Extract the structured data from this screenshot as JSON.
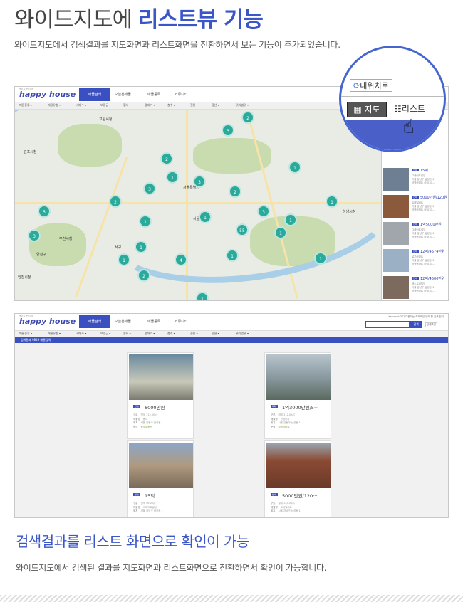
{
  "header": {
    "title_part1": "와이드지도에",
    "title_part2": "리스트뷰 기능",
    "subtitle": "와이드지도에서 검색결과를 지도화면과 리스트화면을 전환하면서 보는 기능이 추가되었습니다."
  },
  "app": {
    "logo": "happy house",
    "logo_small": "좋은집 좋은세상",
    "nav_active": "매물검색",
    "nav_items": [
      "오늘본매물",
      "매물등록",
      "커뮤니티"
    ],
    "filters": [
      "매물종류 ▾",
      "매물유형 ▾",
      "세대수 ▾",
      "보증금 ▾",
      "월세 ▾",
      "평대가 ▾",
      "층수 ▾",
      "전용 ▾",
      "옵션 ▾",
      "위치범위 ▾"
    ]
  },
  "map": {
    "labels": [
      "고양시청",
      "김포시청",
      "서울특별시",
      "서울시청",
      "부천시청",
      "인천시청",
      "하남시청",
      "서구",
      "양천구"
    ],
    "clusters": [
      "2",
      "3",
      "2",
      "1",
      "3",
      "3",
      "2",
      "1",
      "2",
      "3",
      "1",
      "5",
      "3",
      "1",
      "1",
      "55",
      "1",
      "1",
      "1",
      "4",
      "1",
      "2",
      "1",
      "1",
      "1"
    ]
  },
  "magnifier": {
    "location_button": "내위치로",
    "map_button": "지도",
    "list_button": "리스트"
  },
  "side_list": [
    {
      "tag": "전세",
      "price": "15억",
      "desc1": "그레이트빌딩",
      "desc2": "서울 강남구 삼성동 1",
      "desc3": "삼평아파트 @ 010-..."
    },
    {
      "tag": "전세",
      "price": "5000만원/120원",
      "desc1": "르네빌리트",
      "desc2": "서울 강남구 삼성동 1",
      "desc3": "삼평아파트 @ 010-..."
    },
    {
      "tag": "전세",
      "price": "1억5000만원",
      "desc1": "그레이트빌딩",
      "desc2": "서울 강남구 삼성동 1",
      "desc3": "삼평아파트 @ 010-..."
    },
    {
      "tag": "전세",
      "price": "12억/4574만원",
      "desc1": "넓은아파트",
      "desc2": "서울 강남구 삼성동 1",
      "desc3": "삼평아파트 @ 010-..."
    },
    {
      "tag": "전세",
      "price": "12억/4500만원",
      "desc1": "엑스트라빌딩",
      "desc2": "서울 강남구 삼성동 1",
      "desc3": "삼평아파트 @ 010-..."
    }
  ],
  "list_view": {
    "top_right": "Keyword 어디로 원하는 조회조건 입력 할 검색 찾기",
    "search_button": "검색",
    "detail_button": "상세조건",
    "result_bar": "검색결과 9849 매물검색",
    "cards": [
      {
        "tag": "전세",
        "price": "6000만원",
        "r1k": "구분",
        "r1v": "전세 112.00㎡",
        "r2k": "매물명",
        "r2v": "동아",
        "r3k": "위치",
        "r3v": "서울 강동구 삼성동 1",
        "r4k": "문의",
        "r4v": "한국부동산"
      },
      {
        "tag": "매매",
        "price": "1억3000만원/5···",
        "r1k": "구분",
        "r1v": "매매 112.00㎡",
        "r2k": "매물명",
        "r2v": "한경아파",
        "r3k": "위치",
        "r3v": "서울 강동구 삼성동 1",
        "r4k": "문의",
        "r4v": "삼평아파트"
      },
      {
        "tag": "전세",
        "price": "15억",
        "r1k": "구분",
        "r1v": "전세 96.00㎡",
        "r2k": "매물명",
        "r2v": "그레이트빌딩",
        "r3k": "위치",
        "r3v": "서울 강남구 삼성동 1"
      },
      {
        "tag": "월세",
        "price": "5000만원/120···",
        "r1k": "구분",
        "r1v": "월세 124.00㎡",
        "r2k": "매물명",
        "r2v": "르네빌리트",
        "r3k": "위치",
        "r3v": "서울 강남구 삼성동 1"
      }
    ]
  },
  "section2": {
    "title": "검색결과를 리스트 화면으로 확인이 가능",
    "subtitle": "와이드지도에서 검색된 결과를 지도화면과 리스트화면으로 전환하면서 확인이 가능합니다."
  }
}
